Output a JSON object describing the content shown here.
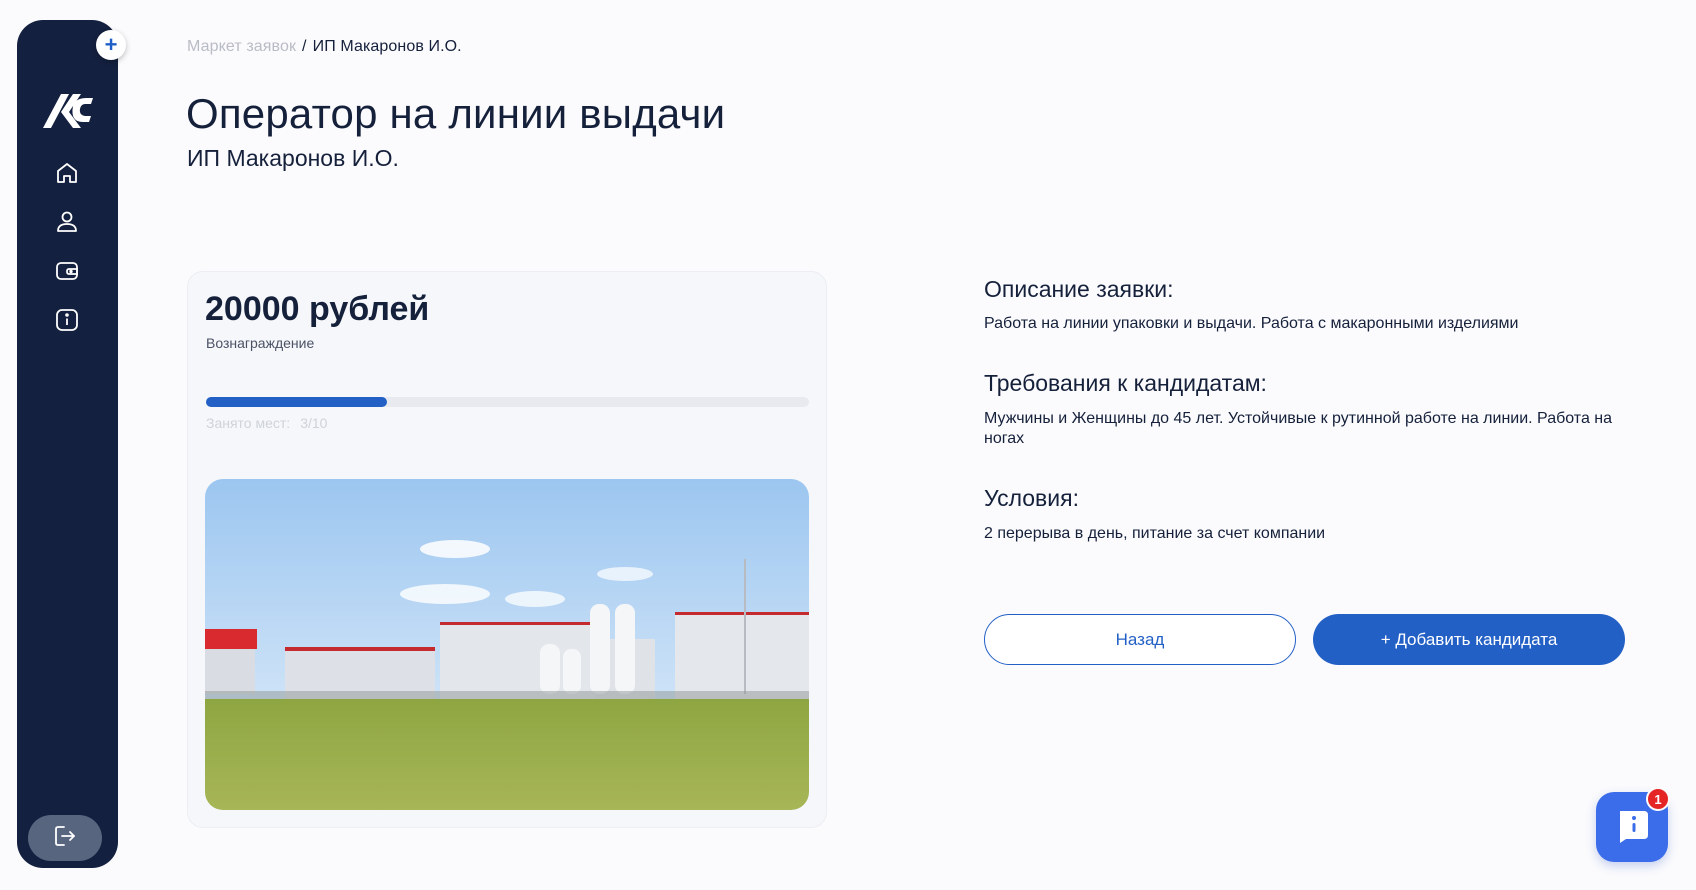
{
  "sidebar": {
    "add_symbol": "+",
    "logo_icon": "company-logo",
    "items": [
      {
        "icon": "home-icon"
      },
      {
        "icon": "user-icon"
      },
      {
        "icon": "wallet-icon"
      },
      {
        "icon": "info-icon"
      }
    ],
    "logout_icon": "logout-icon"
  },
  "breadcrumb": {
    "parent": "Маркет заявок",
    "separator": "/",
    "current": "ИП Макаронов И.О."
  },
  "page": {
    "title": "Оператор на линии выдачи",
    "subtitle": "ИП Макаронов И.О."
  },
  "card": {
    "reward_amount": "20000 рублей",
    "reward_label": "Вознаграждение",
    "progress_label": "Занято мест:",
    "progress_value": "3/10",
    "progress_fraction": 0.3
  },
  "sections": [
    {
      "heading": "Описание заявки:",
      "body": "Работа на линии упаковки и выдачи. Работа с макаронными изделиями"
    },
    {
      "heading": "Требования к кандидатам:",
      "body": "Мужчины и Женщины до 45 лет. Устойчивые к рутинной работе на линии. Работа на ногах"
    },
    {
      "heading": "Условия:",
      "body": "2 перерыва в день, питание за счет компании"
    }
  ],
  "buttons": {
    "back": "Назад",
    "add_candidate": "+ Добавить кандидата"
  },
  "chat": {
    "badge_count": "1",
    "icon": "chat-icon"
  },
  "colors": {
    "sidebar": "#14203f",
    "accent": "#2360c6",
    "background": "#fbfbfd",
    "badge": "#e52525"
  }
}
